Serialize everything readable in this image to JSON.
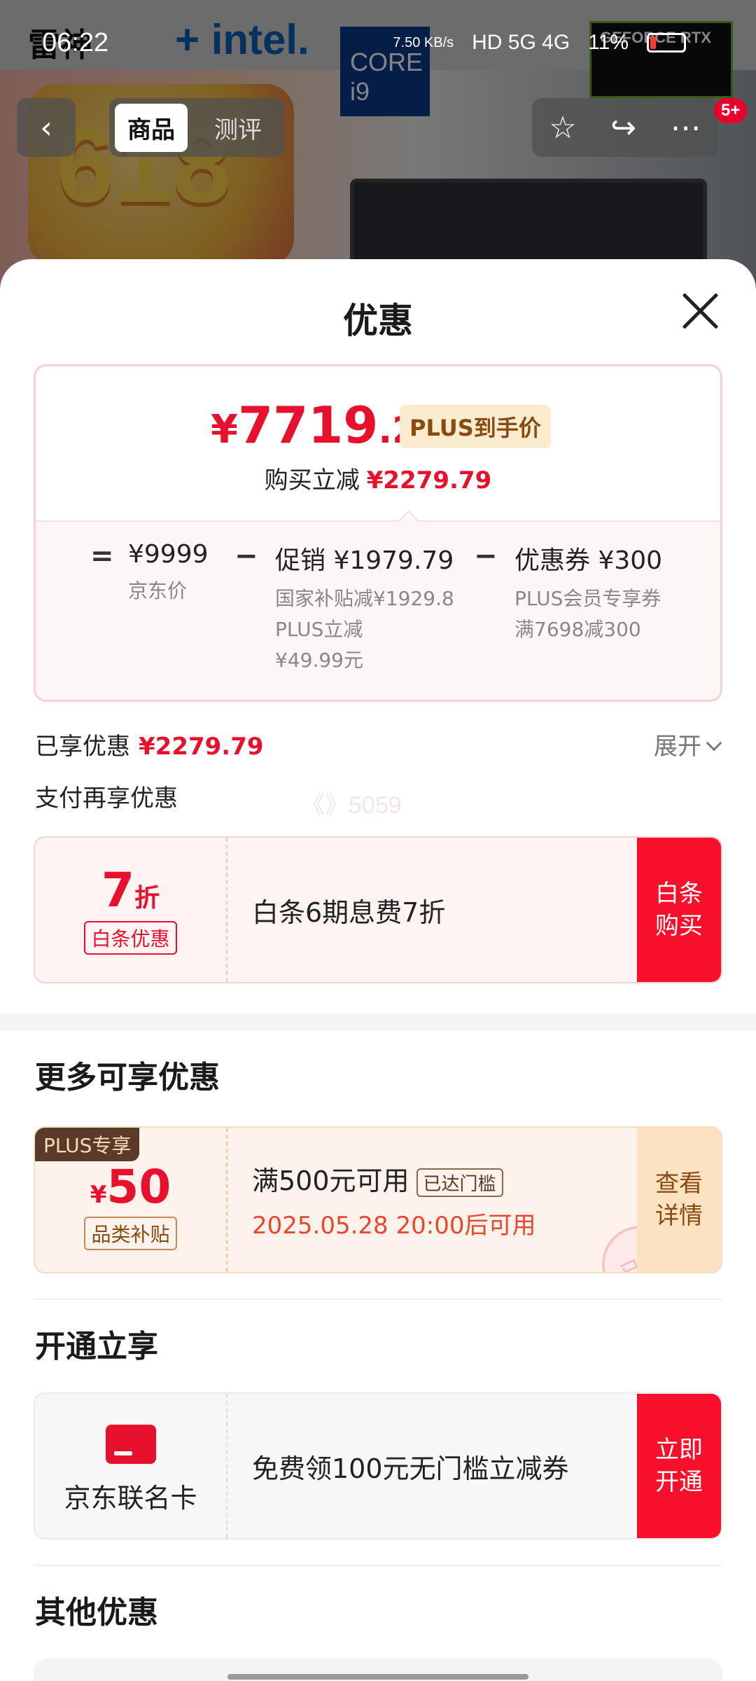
{
  "status_bar": {
    "time": "06:22",
    "net_speed": "7.50 KB/s",
    "network": "HD 5G 4G",
    "battery": "11%"
  },
  "background": {
    "brand_logo": "雷神",
    "intel": "+ intel.",
    "core_badge": "CORE i9",
    "nvidia_badge": "GEFORCE RTX",
    "promo_text": "618",
    "tabs": [
      "商品",
      "测评"
    ],
    "badge": "5+"
  },
  "sheet": {
    "title": "优惠",
    "price_card": {
      "yen": "¥",
      "price_int": "7719",
      "price_dec": ".21",
      "plus_tag": "PLUS到手价",
      "reduce_label": "购买立减",
      "reduce_amount": "¥2279.79",
      "calc": {
        "op_eq": "=",
        "op_minus": "−",
        "jd_price": "¥9999",
        "jd_price_label": "京东价",
        "promo": "促销 ¥1979.79",
        "promo_sub1": "国家补贴减¥1929.8",
        "promo_sub2": "PLUS立减",
        "promo_sub3": "¥49.99元",
        "coupon": "优惠券 ¥300",
        "coupon_sub1": "PLUS会员专享券",
        "coupon_sub2": "满7698减300"
      }
    },
    "enjoyed_label": "已享优惠",
    "enjoyed_amount": "¥2279.79",
    "expand": "展开",
    "pay_more": "支付再享优惠",
    "watermark": "《》5059",
    "baitiao": {
      "discount": "7",
      "unit": "折",
      "tag": "白条优惠",
      "desc": "白条6期息费7折",
      "action": "白条购买"
    },
    "more_title": "更多可享优惠",
    "plus_coupon": {
      "badge": "PLUS专享",
      "yen": "¥",
      "amount": "50",
      "tag": "品类补贴",
      "desc": "满500元可用",
      "threshold": "已达门槛",
      "time": "2025.05.28 20:00后可用",
      "action": "查看详情",
      "stamp": "已领"
    },
    "open_title": "开通立享",
    "jd_card": {
      "name": "京东联名卡",
      "desc": "免费领100元无门槛立减券",
      "action": "立即开通"
    },
    "other_title": "其他优惠"
  }
}
